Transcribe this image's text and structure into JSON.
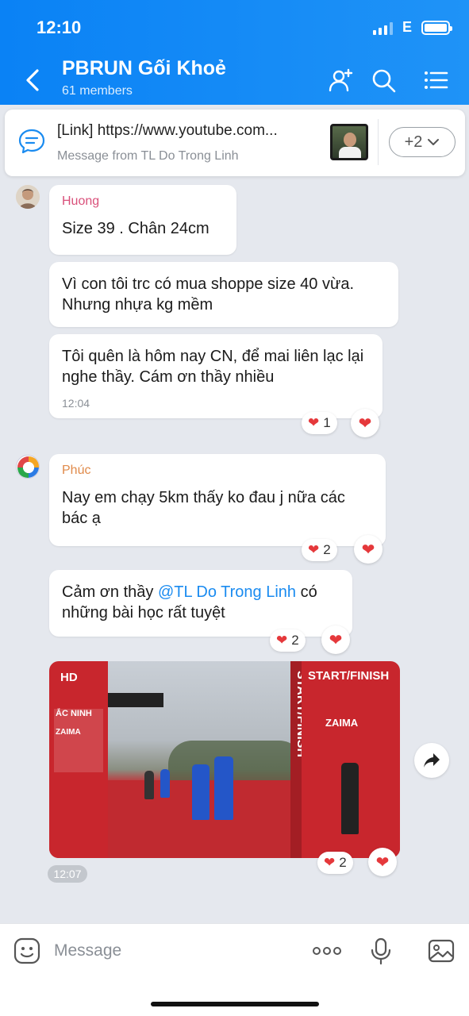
{
  "status_bar": {
    "time": "12:10",
    "network": "E"
  },
  "header": {
    "title": "PBRUN Gối Khoẻ",
    "subtitle": "61 members"
  },
  "pinned": {
    "line1": "[Link] https://www.youtube.com...",
    "line2": "Message from TL Do Trong Linh",
    "more": "+2"
  },
  "messages": [
    {
      "sender": "Huong",
      "text": "Size 39 . Chân 24cm"
    },
    {
      "text": "Vì con tôi trc có mua shoppe size 40 vừa. Nhưng nhựa kg mềm"
    },
    {
      "text": "Tôi quên là hôm nay CN, để mai liên lạc lại nghe thầy. Cám ơn thầy nhiều",
      "time": "12:04",
      "reactions": "1"
    },
    {
      "sender": "Phúc",
      "text": "Nay em chạy 5km thấy ko đau j nữa các bác ạ",
      "reactions": "2"
    },
    {
      "text_before": "Cảm ơn thầy ",
      "mention": "@TL Do Trong Linh",
      "text_after": " có những bài học rất tuyệt",
      "reactions": "2"
    }
  ],
  "video": {
    "badge": "HD",
    "time": "12:07",
    "reactions": "2",
    "signage": {
      "start_finish": "START/FINISH",
      "vertical": "START/FINISH",
      "ac_ninh": "ẮC NINH",
      "zaima": "ZAIMA"
    }
  },
  "composer": {
    "placeholder": "Message"
  },
  "colors": {
    "header": "#0a82f5",
    "accent": "#1a8bf0",
    "heart": "#e5383b",
    "sender_huong": "#d9507a",
    "sender_phuc": "#e08a4a"
  }
}
